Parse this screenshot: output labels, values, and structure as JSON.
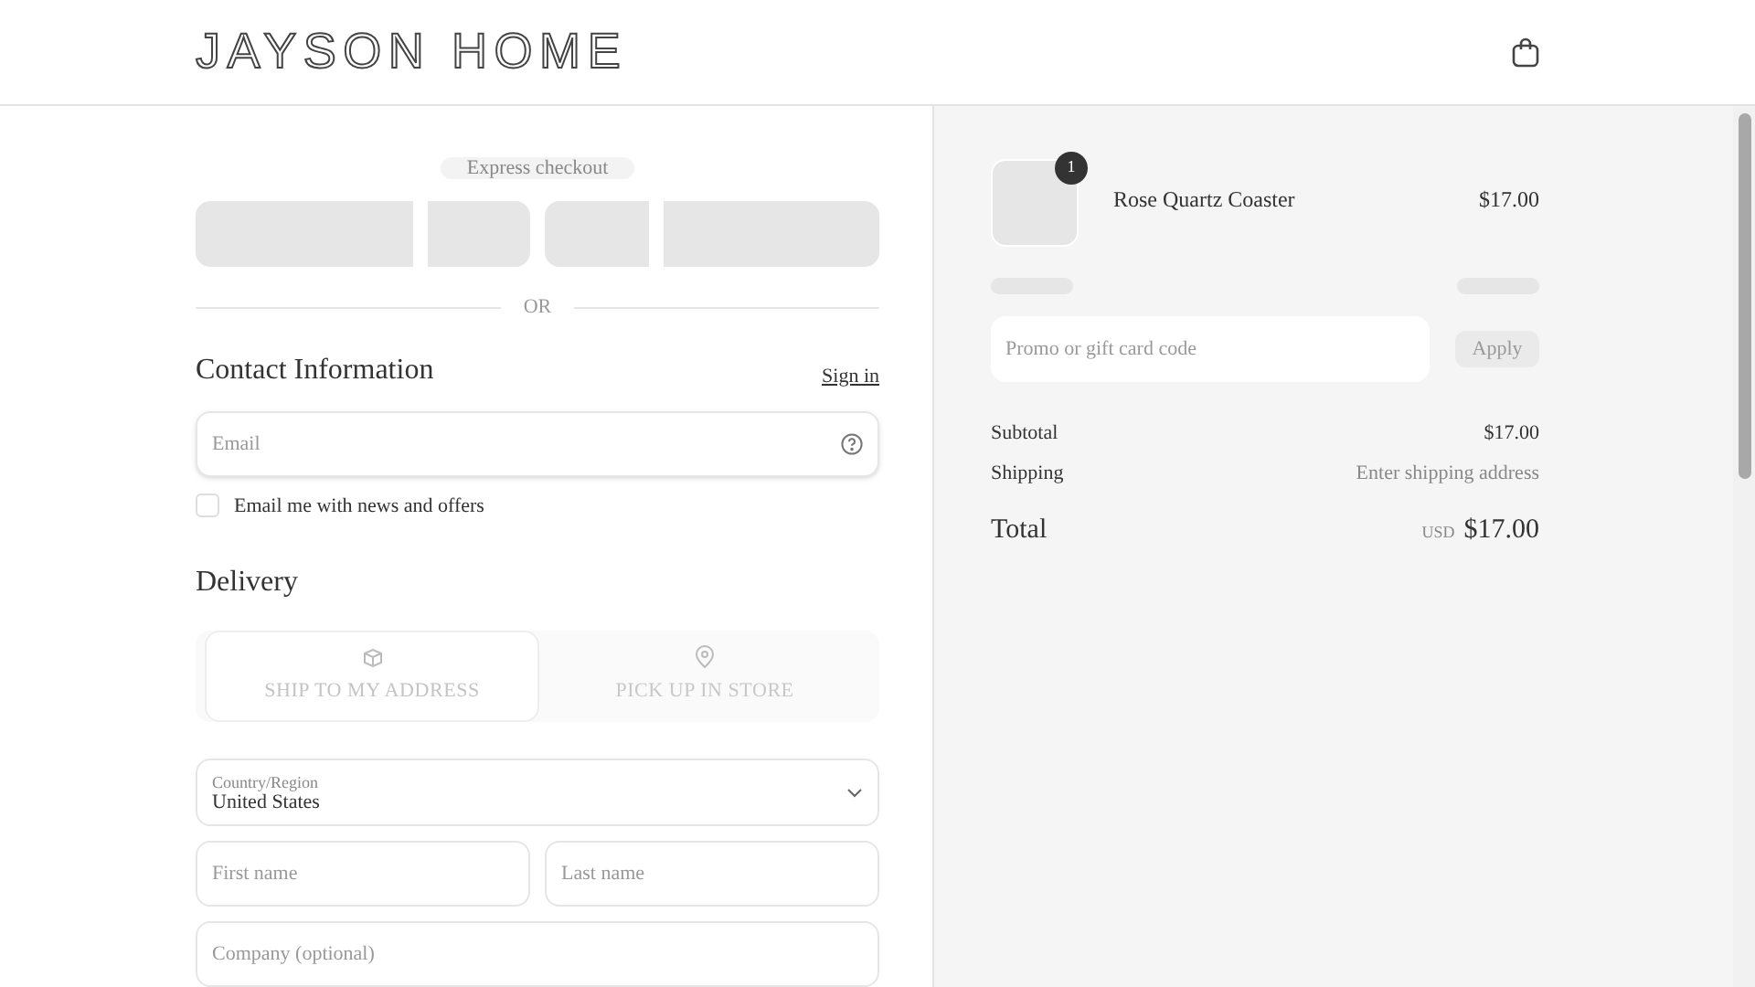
{
  "header": {
    "logo": "JAYSON HOME"
  },
  "express_checkout": {
    "label": "Express checkout"
  },
  "divider": "OR",
  "contact": {
    "title": "Contact Information",
    "sign_in": "Sign in",
    "email": {
      "placeholder": "Email"
    },
    "newsletter": {
      "label": "Email me with news and offers",
      "checked": false
    }
  },
  "delivery": {
    "title": "Delivery",
    "options": [
      {
        "label": "SHIP TO MY ADDRESS",
        "kind": "ship",
        "selected": true
      },
      {
        "label": "PICK UP IN STORE",
        "kind": "store",
        "selected": false
      }
    ],
    "country": {
      "label": "Country/Region",
      "value": "United States"
    },
    "first_name": {
      "placeholder": "First name"
    },
    "last_name": {
      "placeholder": "Last name"
    },
    "company": {
      "placeholder": "Company (optional)"
    }
  },
  "summary": {
    "items": [
      {
        "name": "Rose Quartz Coaster",
        "quantity": "1",
        "price": "$17.00"
      }
    ],
    "promo": {
      "placeholder": "Promo or gift card code",
      "button": "Apply"
    },
    "subtotal": {
      "label": "Subtotal",
      "value": "$17.00"
    },
    "shipping": {
      "label": "Shipping",
      "value": "Enter shipping address"
    },
    "total": {
      "label": "Total",
      "currency": "USD",
      "value": "$17.00"
    }
  }
}
